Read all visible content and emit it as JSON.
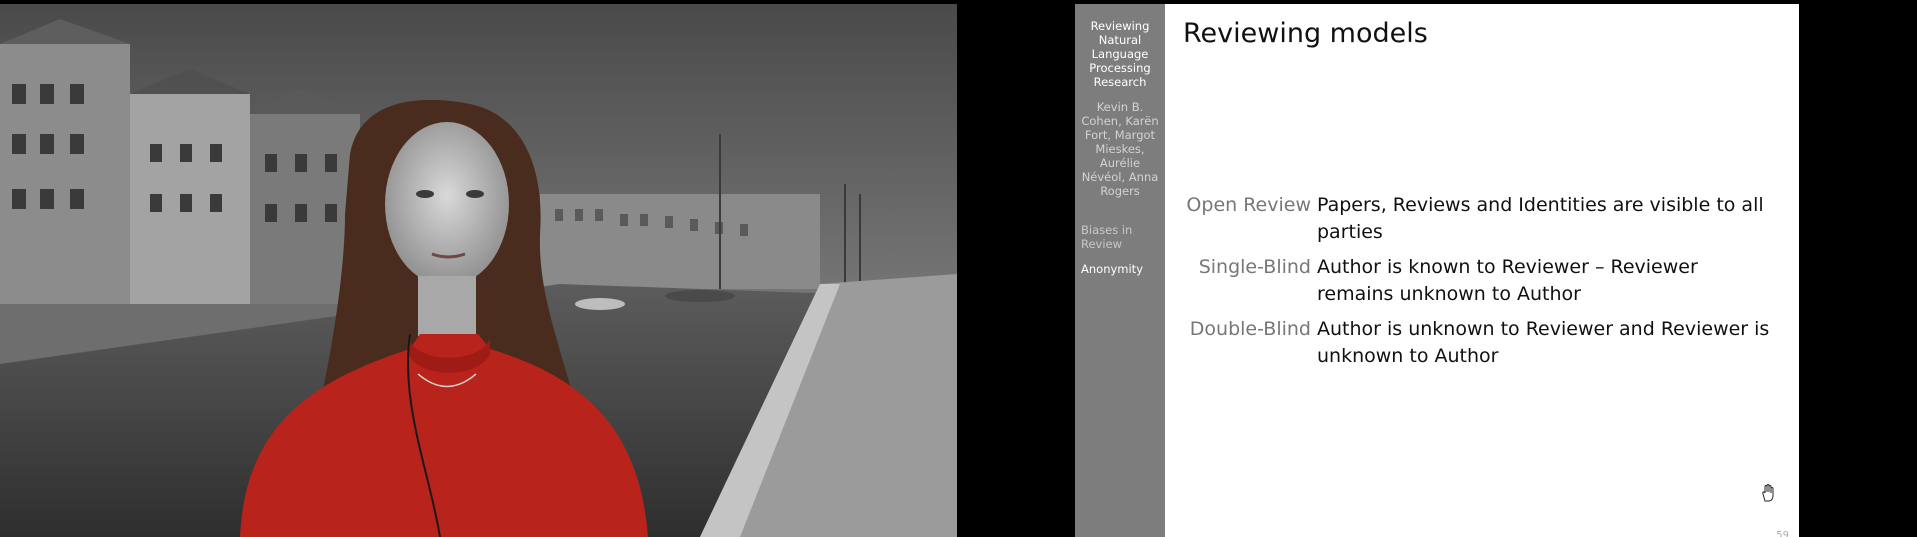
{
  "slide": {
    "sidebar": {
      "title": "Reviewing Natural Language Processing Research",
      "authors": "Kevin B. Cohen, Karën Fort, Margot Mieskes, Aurélie Névéol, Anna Rogers",
      "sections": [
        {
          "label": "Biases in Review",
          "active": false
        },
        {
          "label": "Anonymity",
          "active": true
        }
      ]
    },
    "title": "Reviewing models",
    "definitions": [
      {
        "term": "Open Review",
        "description": "Papers, Reviews and Identities are visible to all parties"
      },
      {
        "term": "Single-Blind",
        "description": "Author is known to Reviewer – Reviewer remains unknown to Author"
      },
      {
        "term": "Double-Blind",
        "description": "Author is unknown to Reviewer and Reviewer is unknown to Author"
      }
    ],
    "page_number": "59"
  },
  "video": {
    "description_icon": "webcam-feed",
    "accent_colors": {
      "sweater": "#b8231b",
      "sidebar": "#7d7d7d"
    }
  }
}
